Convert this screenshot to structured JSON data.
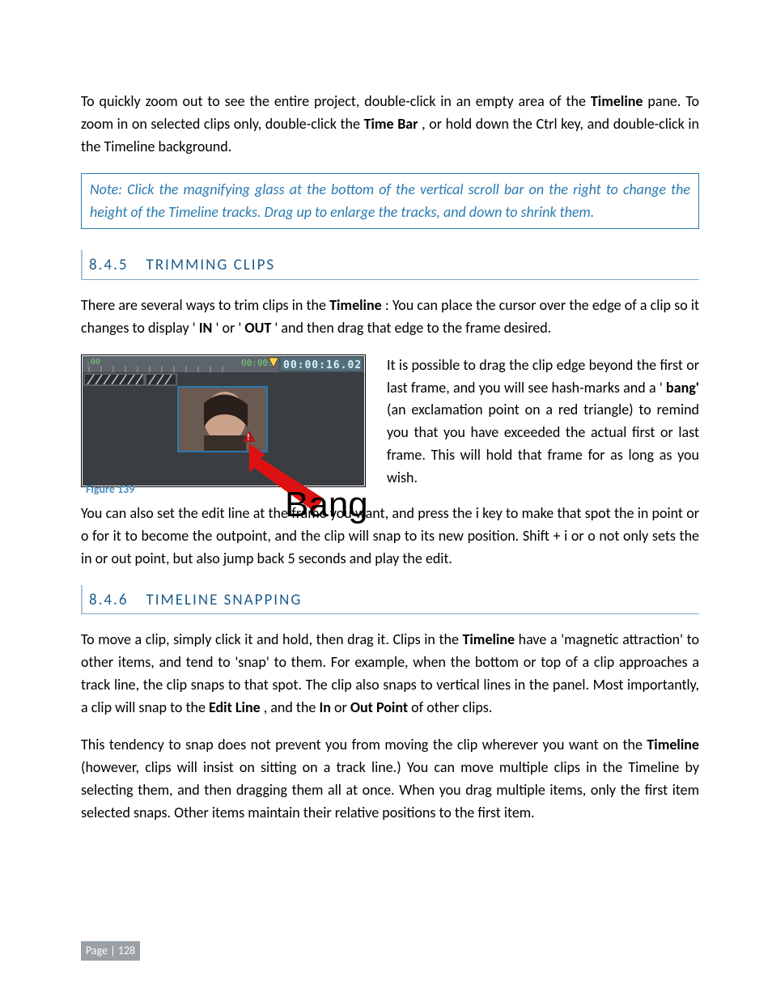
{
  "intro": {
    "p1_a": "To quickly zoom out to see the entire project, double-click in an empty area of the ",
    "p1_b": " pane.  To zoom in on selected clips only, double-click the ",
    "p1_c": ", or hold down the Ctrl key, and double-click in the Timeline background.",
    "bold_timeline": "Timeline",
    "bold_timebar": "Time Bar"
  },
  "note": {
    "text": "Note: Click the magnifying glass at the bottom of the vertical scroll bar on the right to change the height of the Timeline tracks. Drag up to enlarge the tracks, and down to shrink them."
  },
  "section1": {
    "num": "8.4.5",
    "title": "TRIMMING CLIPS",
    "p1_a": "There are several ways to trim clips in the ",
    "p1_b": ": You can place the cursor over the edge of a clip so it changes to display '",
    "p1_c": "' or '",
    "p1_d": "' and then drag that edge to the frame desired.",
    "bold_timeline": "Timeline",
    "bold_in": "IN",
    "bold_out": "OUT",
    "fig_label": "Figure 139",
    "fig_timecode": "00:00:16.02",
    "fig_timecode_small": "00:00:",
    "fig_ruler_mark": ".00",
    "fig_bang_word": "Bang",
    "p2_a": "It is possible to drag the clip edge beyond the first or last frame, and you will see hash-marks and a '",
    "p2_bold_bang": "bang'",
    "p2_b": " (an exclamation point on a red triangle) to remind you that you have exceeded the actual first or last frame. This will hold that frame for as long as you wish.",
    "p3": "You can also set the edit line at the frame you want, and press the i key to make that spot the in point or o for it to become the outpoint, and the clip will snap to its new position. Shift + i or o not only sets the in or out point, but also jump back 5 seconds and play the edit."
  },
  "section2": {
    "num": "8.4.6",
    "title": "TIMELINE SNAPPING",
    "p1_a": "To move a clip, simply click it and hold, then drag it. Clips in the ",
    "p1_bold_timeline": "Timeline",
    "p1_b": " have a 'magnetic attraction' to other items, and tend to 'snap' to them. For example, when the bottom or top of a clip approaches a track line, the clip snaps to that spot. The clip also snaps to vertical lines in the panel.  Most importantly, a clip will snap to the ",
    "p1_bold_editline": "Edit Line",
    "p1_c": ", and the ",
    "p1_bold_in": "In",
    "p1_d": " or ",
    "p1_bold_out": "Out Point",
    "p1_e": " of other clips.",
    "p2_a": "This tendency to snap does not prevent you from moving the clip wherever you want on the ",
    "p2_bold_timeline": "Timeline",
    "p2_b": " (however, clips will insist on sitting on a track line.) You can move multiple clips in the Timeline by selecting them, and then dragging them all at once. When you drag multiple items, only the first item selected snaps.  Other items maintain their relative positions to the first item."
  },
  "footer": {
    "page_label": "Page | 128"
  }
}
